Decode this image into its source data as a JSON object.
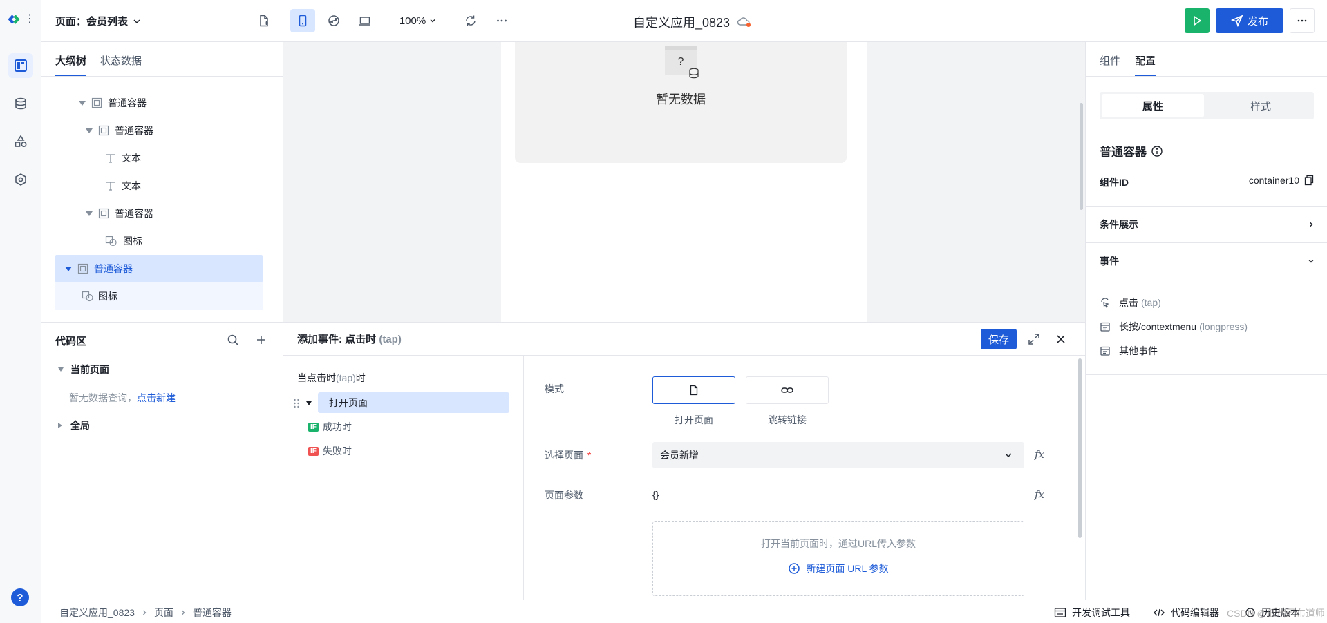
{
  "topbar": {
    "page_selector": "页面：会员列表",
    "zoom": "100%",
    "app_title": "自定义应用_0823",
    "publish": "发布"
  },
  "outline": {
    "tabs": [
      "大纲树",
      "状态数据"
    ],
    "nodes": [
      {
        "label": "普通容器"
      },
      {
        "label": "普通容器"
      },
      {
        "label": "文本"
      },
      {
        "label": "文本"
      },
      {
        "label": "普通容器"
      },
      {
        "label": "图标"
      },
      {
        "label": "普通容器"
      },
      {
        "label": "图标"
      }
    ]
  },
  "code": {
    "title": "代码区",
    "current_page": "当前页面",
    "empty_text": "暂无数据查询，",
    "create_link": "点击新建",
    "global": "全局"
  },
  "canvas": {
    "empty_text": "暂无数据",
    "empty_icon_glyph": "?"
  },
  "event": {
    "title_prefix": "添加事件: 点击时",
    "title_suffix": "(tap)",
    "save": "保存",
    "trigger_prefix": "当点击时",
    "trigger_tap": "(tap)",
    "trigger_suffix": "时",
    "action": "打开页面",
    "success": "成功时",
    "fail": "失败时",
    "if_badge": "IF",
    "mode_label": "模式",
    "mode_open": "打开页面",
    "mode_link": "跳转链接",
    "select_page_label": "选择页面",
    "required_mark": "*",
    "select_page_value": "会员新增",
    "params_label": "页面参数",
    "params_value": "{}",
    "params_hint": "打开当前页面时，通过URL传入参数",
    "new_param": "新建页面 URL 参数",
    "fx": "fx"
  },
  "right": {
    "tabs": [
      "组件",
      "配置"
    ],
    "seg": [
      "属性",
      "样式"
    ],
    "component_title": "普通容器",
    "id_label": "组件ID",
    "id_value": "container10",
    "cond_display": "条件展示",
    "events": "事件",
    "event_items": [
      {
        "name": "点击",
        "code": "(tap)"
      },
      {
        "name": "长按/contextmenu",
        "code": "(longpress)"
      },
      {
        "name": "其他事件",
        "code": ""
      }
    ]
  },
  "status": {
    "breadcrumb": [
      "自定义应用_0823",
      "页面",
      "普通容器"
    ],
    "dev_tools": "开发调试工具",
    "code_editor": "代码编辑器",
    "history": "历史版本",
    "watermark": "CSDN @低代码布道师"
  },
  "colors": {
    "accent": "#1d5bd8",
    "run_green": "#19b36b",
    "fail_red": "#f05252"
  }
}
